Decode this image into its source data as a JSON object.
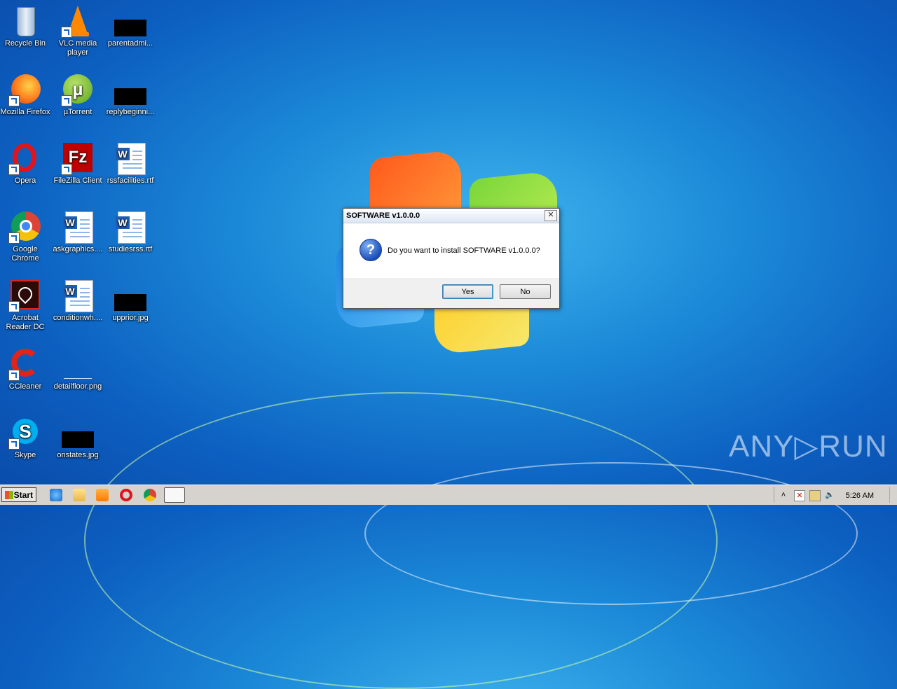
{
  "desktop_icons": [
    {
      "label": "Recycle Bin",
      "icon": "recycle-bin-icon"
    },
    {
      "label": "VLC media player",
      "icon": "vlc-icon"
    },
    {
      "label": "parentadmi...",
      "icon": "black-thumbnail-icon"
    },
    {
      "label": "Mozilla Firefox",
      "icon": "firefox-icon"
    },
    {
      "label": "µTorrent",
      "icon": "utorrent-icon"
    },
    {
      "label": "replybeginni...",
      "icon": "black-thumbnail-icon"
    },
    {
      "label": "Opera",
      "icon": "opera-icon"
    },
    {
      "label": "FileZilla Client",
      "icon": "filezilla-icon"
    },
    {
      "label": "rssfacilities.rtf",
      "icon": "word-doc-icon"
    },
    {
      "label": "Google Chrome",
      "icon": "chrome-icon"
    },
    {
      "label": "askgraphics....",
      "icon": "word-doc-icon"
    },
    {
      "label": "studiesrss.rtf",
      "icon": "word-doc-icon"
    },
    {
      "label": "Acrobat Reader DC",
      "icon": "acrobat-icon"
    },
    {
      "label": "conditionwh....",
      "icon": "word-doc-icon"
    },
    {
      "label": "upprior.jpg",
      "icon": "black-thumbnail-icon"
    },
    {
      "label": "CCleaner",
      "icon": "ccleaner-icon"
    },
    {
      "label": "detailfloor.png",
      "icon": "blank-thumbnail-icon"
    },
    {
      "label": "Skype",
      "icon": "skype-icon"
    },
    {
      "label": "onstates.jpg",
      "icon": "black-thumbnail-icon"
    }
  ],
  "dialog": {
    "title": "SOFTWARE v1.0.0.0",
    "close_label": "✕",
    "message": "Do you want to install SOFTWARE v1.0.0.0?",
    "icon": "question-icon",
    "yes_label": "Yes",
    "no_label": "No"
  },
  "taskbar": {
    "start_label": "Start",
    "pinned": [
      "ie-icon",
      "explorer-icon",
      "media-player-icon",
      "opera-icon",
      "chrome-icon",
      "installer-icon"
    ],
    "tray": {
      "up_arrow": "˄",
      "clock": "5:26 AM"
    }
  },
  "watermark": "ANY▷RUN"
}
